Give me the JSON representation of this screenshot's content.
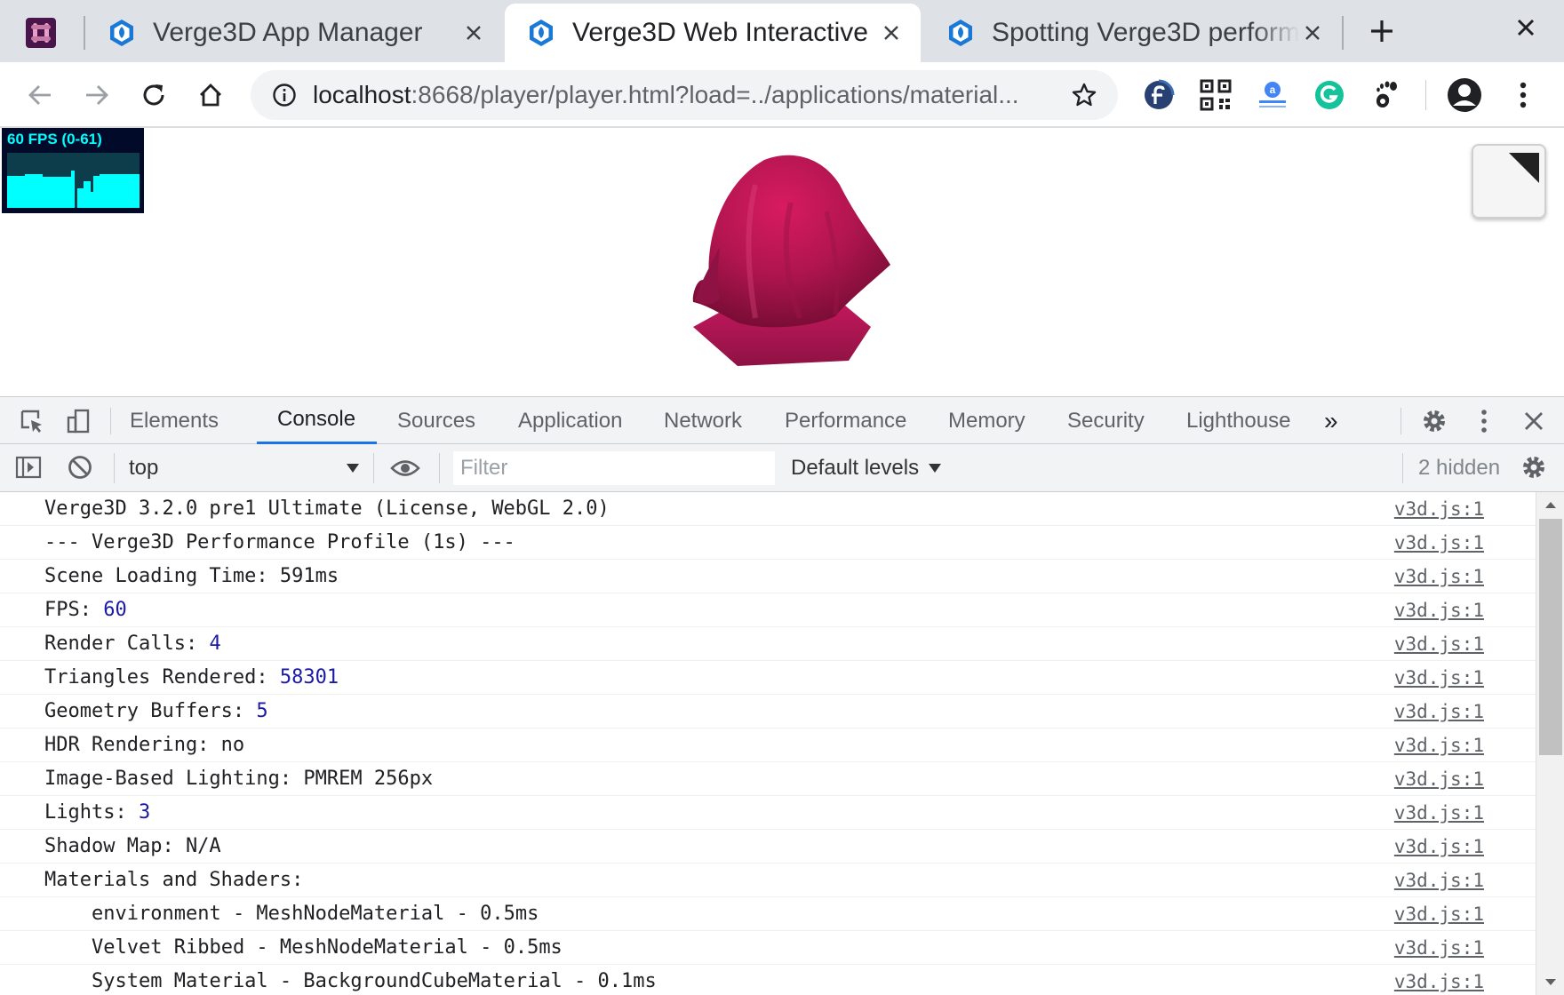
{
  "browser": {
    "tabs": [
      {
        "title": "Verge3D App Manager",
        "active": false
      },
      {
        "title": "Verge3D Web Interactive",
        "active": true
      },
      {
        "title": "Spotting Verge3D perform",
        "active": false
      }
    ],
    "new_tab_icon": "plus-icon",
    "window_close_icon": "close-icon",
    "url_host": "localhost",
    "url_rest": ":8668/player/player.html?load=../applications/material...",
    "extensions": [
      "fedora-icon",
      "qr-code-icon",
      "translate-extension-icon",
      "grammarly-icon",
      "gnome-extension-icon"
    ]
  },
  "viewport": {
    "fps_label": "60 FPS (0-61)",
    "fps_value": 60,
    "fps_range": [
      0,
      61
    ],
    "object_color": "#c2185b"
  },
  "devtools": {
    "tabs": [
      "Elements",
      "Console",
      "Sources",
      "Application",
      "Network",
      "Performance",
      "Memory",
      "Security",
      "Lighthouse"
    ],
    "active_tab": "Console",
    "more_tabs": "»",
    "context": "top",
    "filter_placeholder": "Filter",
    "levels": "Default levels",
    "hidden": "2 hidden",
    "accent": "#1a73e8"
  },
  "console": {
    "source": "v3d.js:1",
    "lines": [
      {
        "label": "Verge3D 3.2.0 pre1 Ultimate (License, WebGL 2.0)",
        "value": ""
      },
      {
        "label": "--- Verge3D Performance Profile (1s) ---",
        "value": ""
      },
      {
        "label": "Scene Loading Time: 591ms",
        "value": ""
      },
      {
        "label": "FPS: ",
        "value": "60"
      },
      {
        "label": "Render Calls: ",
        "value": "4"
      },
      {
        "label": "Triangles Rendered: ",
        "value": "58301"
      },
      {
        "label": "Geometry Buffers: ",
        "value": "5"
      },
      {
        "label": "HDR Rendering: no",
        "value": ""
      },
      {
        "label": "Image-Based Lighting: PMREM 256px",
        "value": ""
      },
      {
        "label": "Lights: ",
        "value": "3"
      },
      {
        "label": "Shadow Map: N/A",
        "value": ""
      },
      {
        "label": "Materials and Shaders:",
        "value": ""
      },
      {
        "label": "environment - MeshNodeMaterial - 0.5ms",
        "value": "",
        "indent": true
      },
      {
        "label": "Velvet Ribbed - MeshNodeMaterial - 0.5ms",
        "value": "",
        "indent": true
      },
      {
        "label": "System Material - BackgroundCubeMaterial - 0.1ms",
        "value": "",
        "indent": true
      }
    ]
  }
}
